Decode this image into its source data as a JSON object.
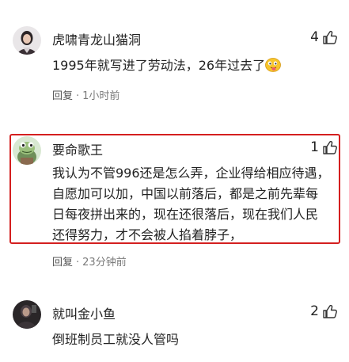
{
  "comments": [
    {
      "username": "虎啸青龙山猫洞",
      "likes": "4",
      "text": "1995年就写进了劳动法，26年过去了",
      "reply_label": "回复",
      "time": "1小时前",
      "avatar_icon": "user-avatar-woman"
    },
    {
      "username": "要命歌王",
      "likes": "1",
      "text": "我认为不管996还是怎么弄，企业得给相应待遇，自愿加可以加，中国以前落后，都是之前先辈每日每夜拼出来的，现在还很落后，现在我们人民还得努力，才不会被人掐着脖子，",
      "reply_label": "回复",
      "time": "23分钟前",
      "avatar_icon": "user-avatar-frog",
      "highlighted": true
    },
    {
      "username": "就叫金小鱼",
      "likes": "2",
      "text": "倒班制员工就没人管吗",
      "avatar_icon": "user-avatar-dark"
    }
  ],
  "colors": {
    "highlight_border": "#d41f1f",
    "meta_text": "#7a7a7a",
    "primary_text": "#222222"
  },
  "icons": {
    "like": "thumbs-up-icon",
    "emoji": "tongue-out-emoji-icon"
  }
}
